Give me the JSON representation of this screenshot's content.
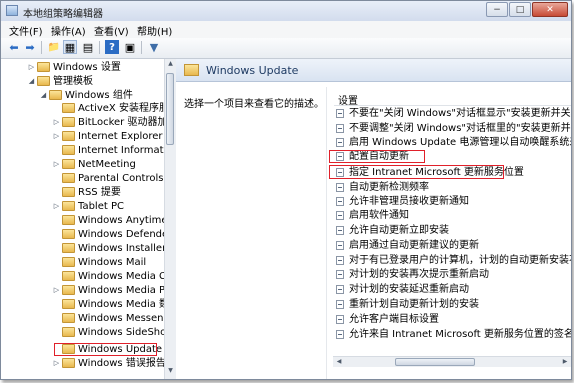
{
  "window": {
    "title": "本地组策略编辑器",
    "controls": {
      "minimize": "−",
      "maximize": "□",
      "close": "✕"
    }
  },
  "menu": [
    "文件(F)",
    "操作(A)",
    "查看(V)",
    "帮助(H)"
  ],
  "toolbar": {
    "icons": [
      "back-arrow-icon",
      "forward-arrow-icon",
      "up-folder-icon",
      "show-tree-icon",
      "properties-icon",
      "help-icon",
      "details-view-icon",
      "filter-icon"
    ],
    "glyphs": [
      "⬅",
      "➡",
      "📁",
      "▦",
      "▤",
      "?",
      "▣",
      "▼"
    ]
  },
  "tree": {
    "items": [
      {
        "label": "Windows 设置",
        "expander": "▷",
        "level": 1
      },
      {
        "label": "管理模板",
        "expander": "◢",
        "level": 1
      },
      {
        "label": "Windows 组件",
        "expander": "◢",
        "level": 2
      },
      {
        "label": "ActiveX 安装程序服务",
        "expander": "",
        "level": 3
      },
      {
        "label": "BitLocker 驱动器加密",
        "expander": "▷",
        "level": 3
      },
      {
        "label": "Internet Explorer",
        "expander": "▷",
        "level": 3
      },
      {
        "label": "Internet Information",
        "expander": "",
        "level": 3
      },
      {
        "label": "NetMeeting",
        "expander": "▷",
        "level": 3
      },
      {
        "label": "Parental Controls",
        "expander": "",
        "level": 3
      },
      {
        "label": "RSS 提要",
        "expander": "",
        "level": 3
      },
      {
        "label": "Tablet PC",
        "expander": "▷",
        "level": 3
      },
      {
        "label": "Windows Anytime Up",
        "expander": "",
        "level": 3
      },
      {
        "label": "Windows Defender",
        "expander": "",
        "level": 3
      },
      {
        "label": "Windows Installer",
        "expander": "",
        "level": 3
      },
      {
        "label": "Windows Mail",
        "expander": "",
        "level": 3
      },
      {
        "label": "Windows Media Cen",
        "expander": "",
        "level": 3
      },
      {
        "label": "Windows Media Play",
        "expander": "▷",
        "level": 3
      },
      {
        "label": "Windows Media 数字",
        "expander": "",
        "level": 3
      },
      {
        "label": "Windows Messenger",
        "expander": "",
        "level": 3
      },
      {
        "label": "Windows SideShow",
        "expander": "",
        "level": 3
      },
      {
        "label": "Windows Update",
        "expander": "",
        "level": 3,
        "selected": true
      },
      {
        "label": "Windows 错误报告",
        "expander": "▷",
        "level": 3
      }
    ]
  },
  "right": {
    "header": "Windows Update",
    "description": "选择一个项目来查看它的描述。",
    "list_header": "设置",
    "rows": [
      "不要在\"关闭 Windows\"对话框显示\"安装更新并关机\"",
      "不要调整\"关闭 Windows\"对话框里的\"安装更新并关机\"",
      "启用 Windows Update 电源管理以自动唤醒系统来安装计",
      "配置自动更新",
      "指定 Intranet Microsoft 更新服务位置",
      "自动更新检测频率",
      "允许非管理员接收更新通知",
      "启用软件通知",
      "允许自动更新立即安装",
      "启用通过自动更新建议的更新",
      "对于有已登录用户的计算机，计划的自动更新安装不执行重",
      "对计划的安装再次提示重新启动",
      "对计划的安装延迟重新启动",
      "重新计划自动更新计划的安装",
      "允许客户端目标设置",
      "允许来自 Intranet Microsoft 更新服务位置的签名更新"
    ]
  },
  "colors": {
    "highlight_border": "#e0202a",
    "header_text": "#1f3b63",
    "folder_fill": "#e8b84e"
  }
}
